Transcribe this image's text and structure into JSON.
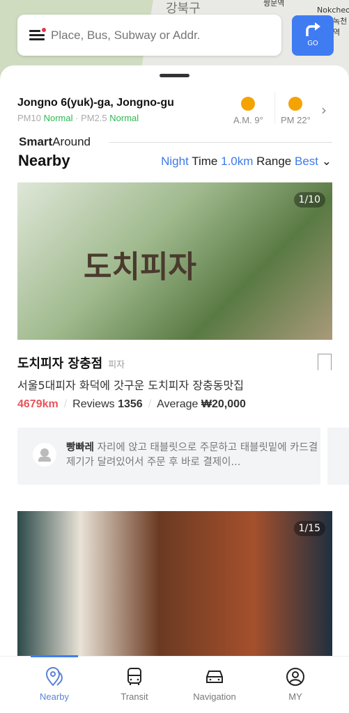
{
  "map": {
    "labels": [
      "강북구",
      "쌍문역",
      "Nokcheon",
      "녹천역"
    ]
  },
  "search": {
    "placeholder": "Place, Bus, Subway or Addr.",
    "go_label": "GO"
  },
  "location": {
    "name": "Jongno 6(yuk)-ga, Jongno-gu",
    "pm10_label": "PM10",
    "pm10_status": "Normal",
    "pm25_label": "PM2.5",
    "pm25_status": "Normal"
  },
  "weather": {
    "am": "A.M. 9°",
    "pm": "PM 22°",
    "icon": "sun-icon",
    "sun_color": "#f5a300"
  },
  "section": {
    "brand_bold": "Smart",
    "brand_light": "Around",
    "title": "Nearby",
    "filter": {
      "time_value": "Night",
      "time_label": "Time",
      "range_value": "1.0km",
      "range_label": "Range",
      "sort_value": "Best"
    }
  },
  "places": [
    {
      "photo_counter": "1/10",
      "sign_text": "도치피자",
      "name": "도치피자 장충점",
      "category": "피자",
      "description": "서울5대피자 화덕에 갓구운 도치피자 장충동맛집",
      "distance": "4679km",
      "reviews_label": "Reviews",
      "reviews_count": "1356",
      "average_label": "Average",
      "average_price": "₩20,000",
      "review": {
        "nickname": "빵빠레",
        "text": "자리에 앉고 태블릿으로 주문하고 태블릿밑에 카드결제기가 달려있어서 주문 후 바로 결제이..."
      }
    },
    {
      "photo_counter": "1/15"
    }
  ],
  "tabs": [
    {
      "label": "Nearby",
      "active": true
    },
    {
      "label": "Transit"
    },
    {
      "label": "Navigation"
    },
    {
      "label": "MY"
    }
  ],
  "colors": {
    "accent": "#3f7cf2",
    "normal": "#2db84e",
    "distance": "#e8535a"
  }
}
